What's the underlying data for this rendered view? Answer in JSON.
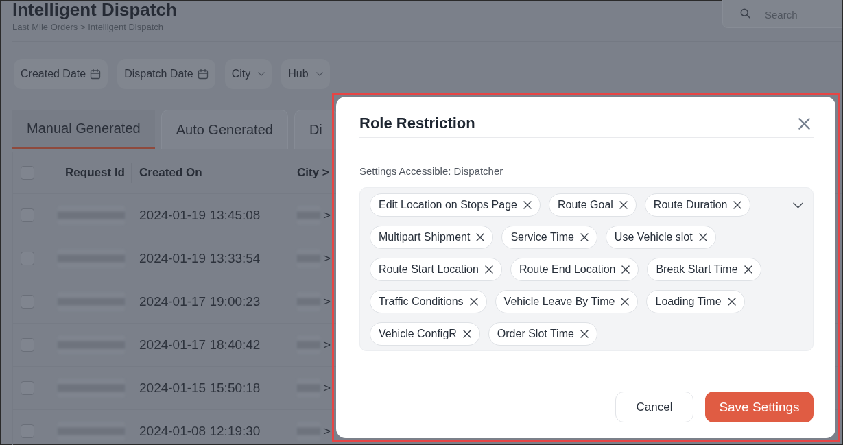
{
  "page": {
    "title": "Intelligent Dispatch",
    "breadcrumb": "Last Mile Orders > Intelligent Dispatch",
    "search": {
      "placeholder": "Search"
    }
  },
  "filters": [
    {
      "label": "Created Date",
      "kind": "date"
    },
    {
      "label": "Dispatch Date",
      "kind": "date"
    },
    {
      "label": "City",
      "kind": "select"
    },
    {
      "label": "Hub",
      "kind": "select"
    }
  ],
  "tabs": [
    {
      "label": "Manual Generated",
      "selected": true
    },
    {
      "label": "Auto Generated",
      "selected": false
    },
    {
      "label": "Di",
      "selected": false
    }
  ],
  "table": {
    "select_all_checked": false,
    "columns": [
      "Request Id",
      "Created On",
      "City >"
    ],
    "rows": [
      {
        "checked": false,
        "created_on": "2024-01-19 13:45:08",
        "city_fragment": ">"
      },
      {
        "checked": false,
        "created_on": "2024-01-19 13:33:54",
        "city_fragment": ">"
      },
      {
        "checked": false,
        "created_on": "2024-01-17 19:00:23",
        "city_fragment": ">"
      },
      {
        "checked": false,
        "created_on": "2024-01-17 18:40:42",
        "city_fragment": ">"
      },
      {
        "checked": false,
        "created_on": "2024-01-15 15:50:18",
        "city_fragment": ">"
      },
      {
        "checked": false,
        "created_on": "2024-01-08 12:19:30",
        "city_fragment": ">"
      }
    ]
  },
  "dialog": {
    "title": "Role Restriction",
    "label": "Settings Accessible: Dispatcher",
    "tags": [
      "Edit Location on Stops Page",
      "Route Goal",
      "Route Duration",
      "Multipart Shipment",
      "Service Time",
      "Use Vehicle slot",
      "Route Start Location",
      "Route End Location",
      "Break Start Time",
      "Traffic Conditions",
      "Vehicle Leave By Time",
      "Loading Time",
      "Vehicle ConfigR",
      "Order Slot Time"
    ],
    "buttons": [
      {
        "label": "Cancel",
        "kind": "secondary"
      },
      {
        "label": "Save Settings",
        "kind": "primary"
      }
    ]
  }
}
